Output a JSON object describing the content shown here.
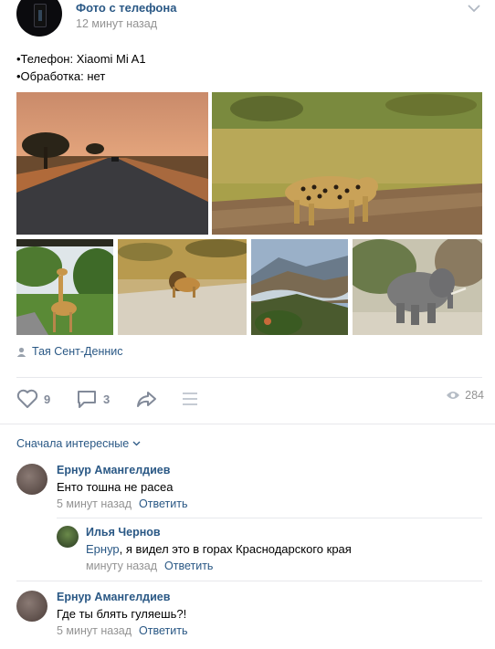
{
  "post": {
    "author": "Фото с телефона",
    "time": "12 минут назад",
    "text_lines": [
      "•Телефон: Xiaomi Mi A1",
      "•Обработка: нет"
    ],
    "signer": "Тая Сент-Деннис",
    "photos": [
      "road-sunset",
      "leopard",
      "giraffe",
      "lion",
      "canyon",
      "elephant"
    ]
  },
  "actions": {
    "likes": "9",
    "comments": "3",
    "views": "284"
  },
  "comments_header": {
    "sort_label": "Сначала интересные"
  },
  "comments": [
    {
      "name": "Ернур Амангелдиев",
      "text": "Енто тошна не расеа",
      "time": "5 минут назад",
      "reply": "Ответить"
    },
    {
      "name": "Илья Чернов",
      "mention": "Ернур",
      "text": ", я видел это в горах Краснодарского края",
      "time": "минуту назад",
      "reply": "Ответить"
    },
    {
      "name": "Ернур Амангелдиев",
      "text": "Где ты блять гуляешь?!",
      "time": "5 минут назад",
      "reply": "Ответить"
    }
  ],
  "colors": {
    "link": "#2a5885",
    "meta": "#939393",
    "icon": "#828a99",
    "divider": "#e7e8ec"
  }
}
